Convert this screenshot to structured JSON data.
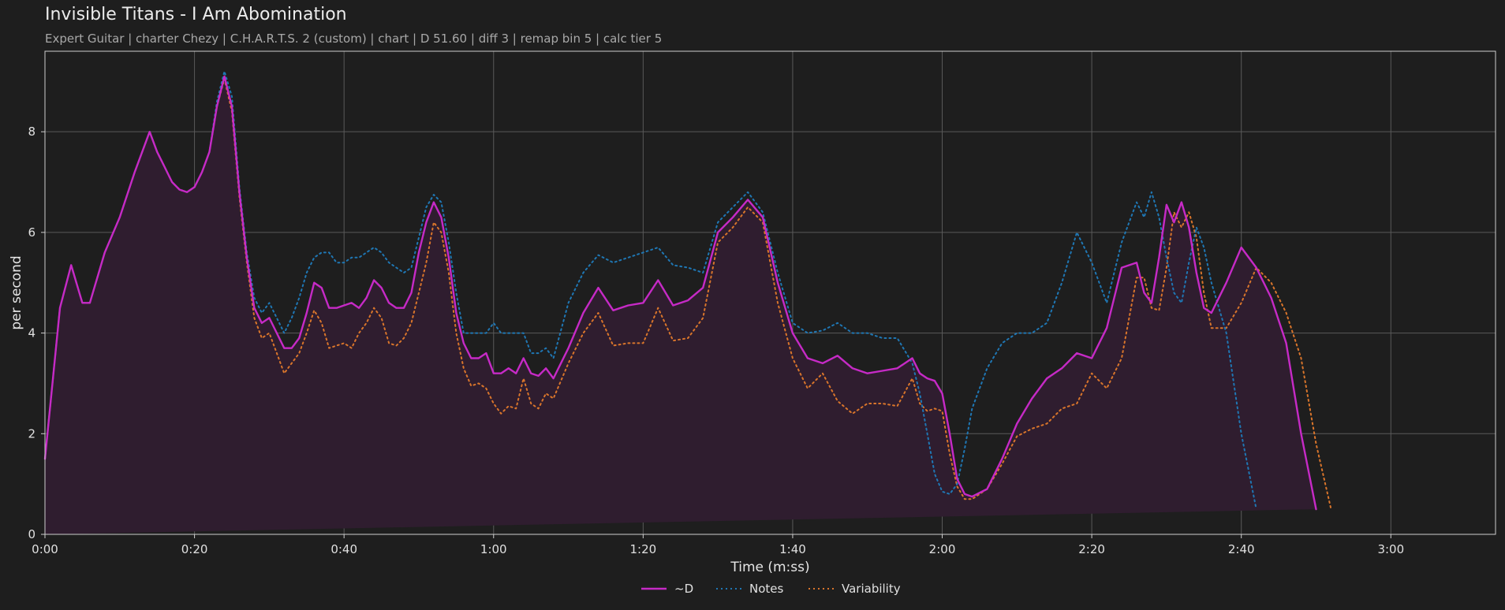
{
  "header": {
    "title": "Invisible Titans - I Am Abomination",
    "subtitle": "Expert Guitar  |  charter Chezy  |  C.H.A.R.T.S. 2 (custom)  |  chart  |  D 51.60  |  diff 3  |  remap bin 5  |  calc tier 5"
  },
  "colors": {
    "background": "#1e1e1e",
    "grid": "#5a5a5a",
    "d_series": "#c62ac6",
    "notes_series": "#1f77b4",
    "variability_series": "#d9752b",
    "fill": "#2f1d2f"
  },
  "chart_data": {
    "type": "line",
    "title": "Invisible Titans - I Am Abomination",
    "xlabel": "Time (m:ss)",
    "ylabel": "per second",
    "xlim": [
      0,
      194
    ],
    "ylim": [
      0,
      9.6
    ],
    "grid": true,
    "legend_position": "bottom-center",
    "x_ticks": [
      "0:00",
      "0:20",
      "0:40",
      "1:00",
      "1:20",
      "1:40",
      "2:00",
      "2:20",
      "2:40",
      "3:00"
    ],
    "x_tick_values": [
      0,
      20,
      40,
      60,
      80,
      100,
      120,
      140,
      160,
      180
    ],
    "y_ticks": [
      "0",
      "2",
      "4",
      "6",
      "8"
    ],
    "y_tick_values": [
      0,
      2,
      4,
      6,
      8
    ],
    "x": [
      0,
      2,
      3.5,
      5,
      6,
      8,
      10,
      12,
      14,
      15,
      16,
      17,
      18,
      19,
      20,
      21,
      22,
      23,
      24,
      25,
      26,
      27,
      28,
      29,
      30,
      31,
      32,
      33,
      34,
      35,
      36,
      37,
      38,
      39,
      40,
      41,
      42,
      43,
      44,
      45,
      46,
      47,
      48,
      49,
      50,
      51,
      52,
      53,
      54,
      55,
      56,
      57,
      58,
      59,
      60,
      61,
      62,
      63,
      64,
      65,
      66,
      67,
      68,
      70,
      72,
      74,
      76,
      78,
      80,
      82,
      84,
      86,
      88,
      90,
      92,
      94,
      96,
      98,
      100,
      102,
      104,
      106,
      108,
      110,
      112,
      114,
      116,
      117,
      118,
      119,
      120,
      121,
      122,
      123,
      124,
      126,
      128,
      130,
      132,
      134,
      136,
      138,
      140,
      142,
      144,
      146,
      147,
      148,
      149,
      150,
      151,
      152,
      153,
      154,
      155,
      156,
      158,
      160,
      162,
      164,
      166,
      168,
      170,
      172,
      173,
      174,
      175,
      176,
      177,
      178,
      179,
      180,
      181,
      182,
      183,
      184,
      185,
      186,
      187,
      188,
      189,
      190,
      191,
      192,
      193,
      194
    ],
    "series": [
      {
        "name": "~D",
        "style": "solid",
        "values": [
          1.5,
          4.5,
          5.35,
          4.6,
          4.6,
          5.6,
          6.3,
          7.2,
          8.0,
          7.6,
          7.3,
          7.0,
          6.85,
          6.8,
          6.9,
          7.2,
          7.6,
          8.5,
          9.1,
          8.5,
          6.8,
          5.5,
          4.5,
          4.2,
          4.3,
          4.0,
          3.7,
          3.7,
          3.9,
          4.4,
          5.0,
          4.9,
          4.5,
          4.5,
          4.55,
          4.6,
          4.5,
          4.7,
          5.05,
          4.9,
          4.6,
          4.5,
          4.5,
          4.8,
          5.6,
          6.2,
          6.6,
          6.3,
          5.5,
          4.4,
          3.8,
          3.5,
          3.5,
          3.6,
          3.2,
          3.2,
          3.3,
          3.2,
          3.5,
          3.2,
          3.15,
          3.3,
          3.1,
          3.7,
          4.4,
          4.9,
          4.45,
          4.55,
          4.6,
          5.05,
          4.55,
          4.65,
          4.9,
          6.0,
          6.3,
          6.65,
          6.3,
          5.0,
          4.0,
          3.5,
          3.4,
          3.55,
          3.3,
          3.2,
          3.25,
          3.3,
          3.5,
          3.2,
          3.1,
          3.05,
          2.8,
          2.0,
          1.1,
          0.8,
          0.75,
          0.9,
          1.5,
          2.2,
          2.7,
          3.1,
          3.3,
          3.6,
          3.5,
          4.1,
          5.3,
          5.4,
          4.8,
          4.6,
          5.5,
          6.55,
          6.2,
          6.6,
          6.1,
          5.2,
          4.5,
          4.4,
          5.0,
          5.7,
          5.3,
          4.7,
          3.8,
          2.0,
          0.5
        ]
      },
      {
        "name": "Notes",
        "style": "dotted",
        "values": [
          1.5,
          4.5,
          5.35,
          4.6,
          4.6,
          5.6,
          6.3,
          7.2,
          8.0,
          7.6,
          7.3,
          7.0,
          6.85,
          6.8,
          6.9,
          7.2,
          7.6,
          8.6,
          9.2,
          8.7,
          6.9,
          5.6,
          4.7,
          4.4,
          4.6,
          4.3,
          4.0,
          4.3,
          4.7,
          5.2,
          5.5,
          5.6,
          5.6,
          5.4,
          5.4,
          5.5,
          5.5,
          5.6,
          5.7,
          5.6,
          5.4,
          5.3,
          5.2,
          5.3,
          5.9,
          6.5,
          6.75,
          6.6,
          5.8,
          4.8,
          4.0,
          4.0,
          4.0,
          4.0,
          4.2,
          4.0,
          4.0,
          4.0,
          4.0,
          3.6,
          3.6,
          3.7,
          3.5,
          4.6,
          5.2,
          5.55,
          5.4,
          5.5,
          5.6,
          5.7,
          5.35,
          5.3,
          5.2,
          6.2,
          6.5,
          6.8,
          6.4,
          5.2,
          4.2,
          4.0,
          4.05,
          4.2,
          4.0,
          4.0,
          3.9,
          3.9,
          3.4,
          2.8,
          2.0,
          1.2,
          0.85,
          0.8,
          1.0,
          1.7,
          2.5,
          3.3,
          3.8,
          4.0,
          4.0,
          4.2,
          5.0,
          6.0,
          5.4,
          4.6,
          5.8,
          6.6,
          6.3,
          6.8,
          6.3,
          5.5,
          4.8,
          4.6,
          5.4,
          6.1,
          5.7,
          5.0,
          4.0,
          2.0,
          0.5
        ]
      },
      {
        "name": "Variability",
        "style": "dotted",
        "values": [
          1.5,
          4.5,
          5.35,
          4.6,
          4.6,
          5.6,
          6.3,
          7.2,
          8.0,
          7.6,
          7.3,
          7.0,
          6.85,
          6.8,
          6.9,
          7.2,
          7.6,
          8.5,
          9.05,
          8.4,
          6.7,
          5.4,
          4.3,
          3.9,
          4.0,
          3.6,
          3.2,
          3.4,
          3.6,
          4.0,
          4.45,
          4.2,
          3.7,
          3.75,
          3.8,
          3.7,
          4.0,
          4.2,
          4.5,
          4.3,
          3.8,
          3.75,
          3.9,
          4.2,
          4.8,
          5.4,
          6.2,
          6.0,
          5.2,
          4.0,
          3.3,
          2.95,
          3.0,
          2.9,
          2.6,
          2.4,
          2.55,
          2.5,
          3.1,
          2.6,
          2.5,
          2.8,
          2.7,
          3.4,
          4.0,
          4.4,
          3.75,
          3.8,
          3.8,
          4.5,
          3.85,
          3.9,
          4.3,
          5.8,
          6.1,
          6.5,
          6.2,
          4.6,
          3.5,
          2.9,
          3.2,
          2.65,
          2.4,
          2.6,
          2.6,
          2.55,
          3.1,
          2.6,
          2.45,
          2.5,
          2.45,
          1.6,
          0.95,
          0.7,
          0.7,
          0.9,
          1.4,
          1.95,
          2.1,
          2.2,
          2.5,
          2.6,
          3.2,
          2.9,
          3.5,
          5.1,
          5.1,
          4.5,
          4.45,
          5.3,
          6.4,
          6.1,
          6.4,
          5.9,
          4.8,
          4.1,
          4.1,
          4.6,
          5.3,
          5.0,
          4.4,
          3.5,
          1.8,
          0.5
        ]
      }
    ]
  }
}
